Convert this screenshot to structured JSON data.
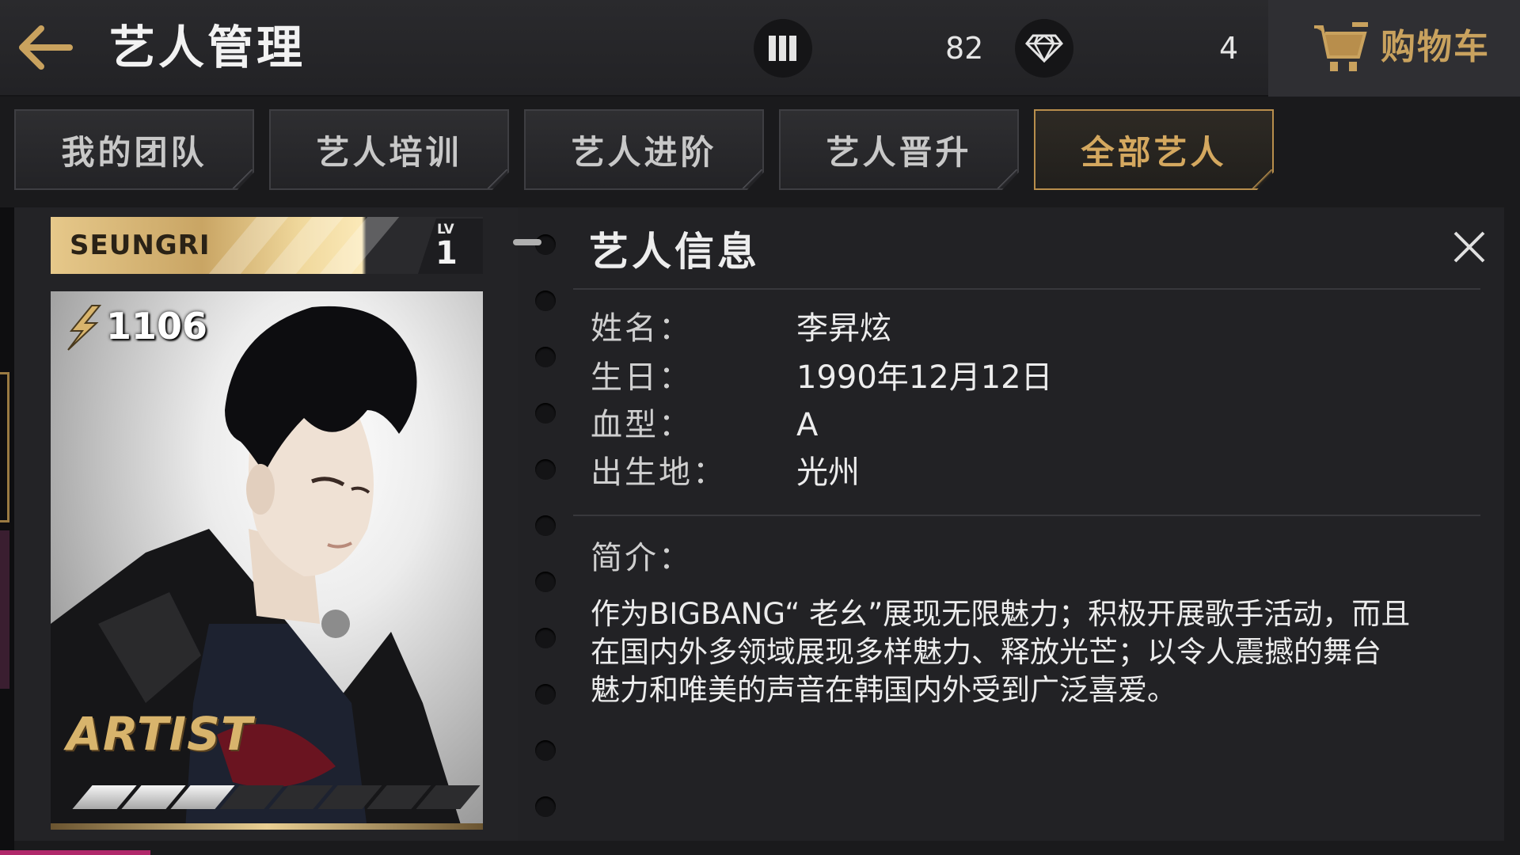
{
  "header": {
    "title": "艺人管理",
    "back_icon": "arrow-left-icon",
    "resource_1": {
      "icon": "energy-bars-icon",
      "value": "82"
    },
    "resource_2": {
      "icon": "diamond-icon",
      "value": "4"
    },
    "shop": {
      "icon": "shopping-cart-icon",
      "label": "购物车"
    }
  },
  "tabs": [
    {
      "label": "我的团队",
      "active": false
    },
    {
      "label": "艺人培训",
      "active": false
    },
    {
      "label": "艺人进阶",
      "active": false
    },
    {
      "label": "艺人晋升",
      "active": false
    },
    {
      "label": "全部艺人",
      "active": true
    }
  ],
  "card": {
    "name_en": "SEUNGRI",
    "level_label": "LV",
    "level": "1",
    "power": "1106",
    "power_icon": "lightning-icon",
    "badge_text": "ARTIST",
    "progress_filled": 3,
    "progress_total": 8
  },
  "info": {
    "title": "艺人信息",
    "close_icon": "close-icon",
    "fields": [
      {
        "label": "姓名：",
        "value": "李昇炫"
      },
      {
        "label": "生日：",
        "value": "1990年12月12日"
      },
      {
        "label": "血型：",
        "value": "A"
      },
      {
        "label": "出生地：",
        "value": "光州"
      }
    ],
    "bio_label": "简介：",
    "bio_lines": [
      "作为BIGBANG“ 老幺”展现无限魅力；积极开展歌手活动，而且",
      "在国内外多领域展现多样魅力、释放光芒；以令人震撼的舞台",
      "魅力和唯美的声音在韩国内外受到广泛喜爱。"
    ]
  },
  "colors": {
    "gold": "#c9a25e",
    "active_tab_border": "#b88e4c",
    "background": "#1a1a1c",
    "panel": "#222225"
  }
}
